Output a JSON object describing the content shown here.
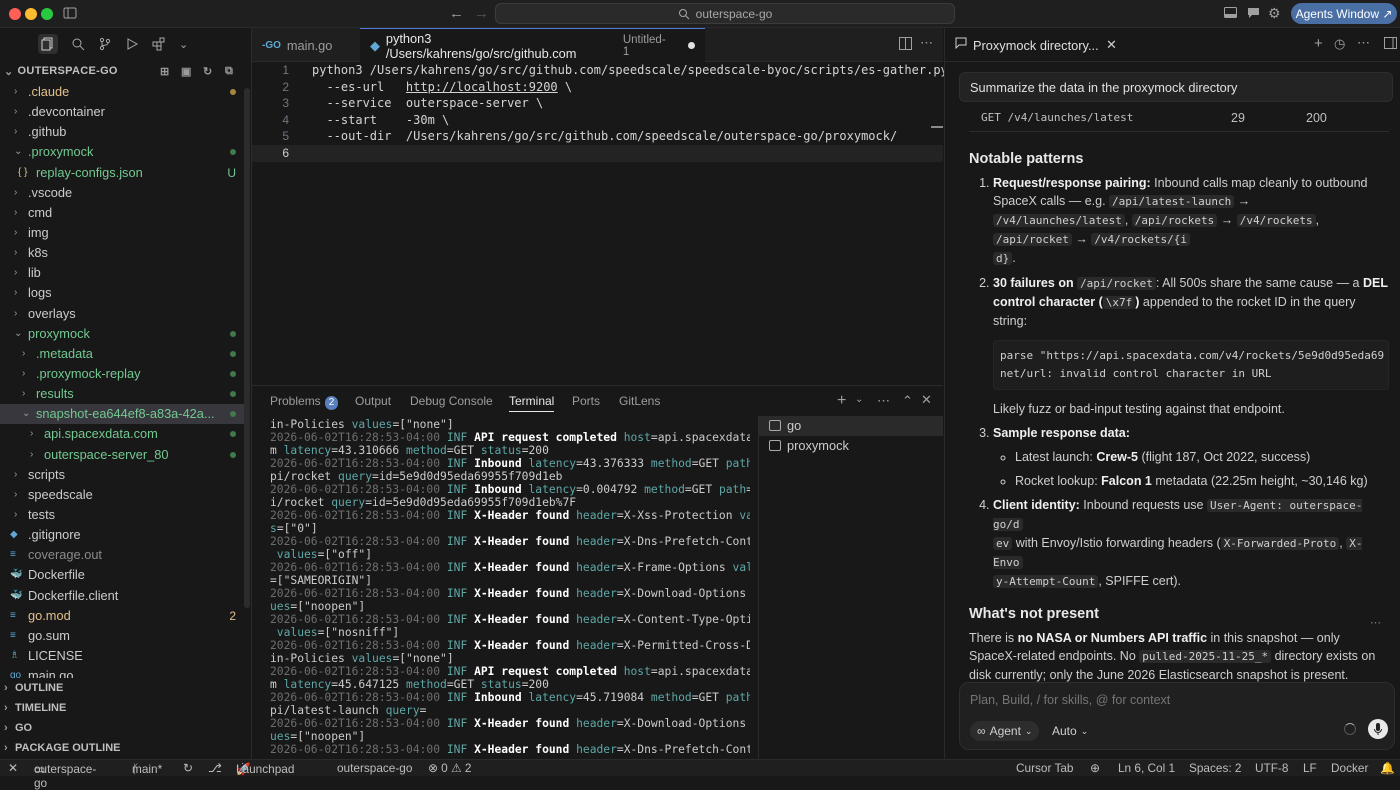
{
  "titlebar": {
    "search": "outerspace-go",
    "agents_button": "Agents Window ↗"
  },
  "explorer": {
    "title": "OUTERSPACE-GO",
    "items": [
      {
        "label": ".claude",
        "indent": 0,
        "chev": "›",
        "mark": "dot-yellow",
        "color": "#e2c08d"
      },
      {
        "label": ".devcontainer",
        "indent": 0,
        "chev": "›"
      },
      {
        "label": ".github",
        "indent": 0,
        "chev": "›"
      },
      {
        "label": ".proxymock",
        "indent": 0,
        "chev": "⌄",
        "mark": "dot",
        "color": "#73c991"
      },
      {
        "label": "replay-configs.json",
        "indent": 1,
        "icon": "{ }",
        "badge": "U",
        "color": "#73c991"
      },
      {
        "label": ".vscode",
        "indent": 0,
        "chev": "›"
      },
      {
        "label": "cmd",
        "indent": 0,
        "chev": "›"
      },
      {
        "label": "img",
        "indent": 0,
        "chev": "›"
      },
      {
        "label": "k8s",
        "indent": 0,
        "chev": "›"
      },
      {
        "label": "lib",
        "indent": 0,
        "chev": "›"
      },
      {
        "label": "logs",
        "indent": 0,
        "chev": "›"
      },
      {
        "label": "overlays",
        "indent": 0,
        "chev": "›"
      },
      {
        "label": "proxymock",
        "indent": 0,
        "chev": "⌄",
        "mark": "dot",
        "color": "#73c991"
      },
      {
        "label": ".metadata",
        "indent": 1,
        "chev": "›",
        "mark": "dot",
        "color": "#73c991"
      },
      {
        "label": ".proxymock-replay",
        "indent": 1,
        "chev": "›",
        "mark": "dot",
        "color": "#73c991"
      },
      {
        "label": "results",
        "indent": 1,
        "chev": "›",
        "mark": "dot",
        "color": "#73c991"
      },
      {
        "label": "snapshot-ea644ef8-a83a-42a...",
        "indent": 1,
        "chev": "⌄",
        "mark": "dot",
        "color": "#73c991",
        "selected": true
      },
      {
        "label": "api.spacexdata.com",
        "indent": 2,
        "chev": "›",
        "mark": "dot",
        "color": "#73c991"
      },
      {
        "label": "outerspace-server_80",
        "indent": 2,
        "chev": "›",
        "mark": "dot",
        "color": "#73c991"
      },
      {
        "label": "scripts",
        "indent": 0,
        "chev": "›"
      },
      {
        "label": "speedscale",
        "indent": 0,
        "chev": "›"
      },
      {
        "label": "tests",
        "indent": 0,
        "chev": "›"
      },
      {
        "label": ".gitignore",
        "indent": 0,
        "icon": "◆"
      },
      {
        "label": "coverage.out",
        "indent": 0,
        "icon": "≡",
        "color": "#8a8a8a"
      },
      {
        "label": "Dockerfile",
        "indent": 0,
        "icon": "🐳"
      },
      {
        "label": "Dockerfile.client",
        "indent": 0,
        "icon": "🐳"
      },
      {
        "label": "go.mod",
        "indent": 0,
        "icon": "≡",
        "badge": "2",
        "color": "#e2c08d"
      },
      {
        "label": "go.sum",
        "indent": 0,
        "icon": "≡"
      },
      {
        "label": "LICENSE",
        "indent": 0,
        "icon": "♗"
      },
      {
        "label": "main.go",
        "indent": 0,
        "icon": "go"
      }
    ],
    "sections": [
      "OUTLINE",
      "TIMELINE",
      "GO",
      "PACKAGE OUTLINE"
    ]
  },
  "editor": {
    "tabs": [
      {
        "icon": "-GO",
        "label": "main.go",
        "active": false
      },
      {
        "icon": "py",
        "label": "python3 /Users/kahrens/go/src/github.com",
        "suffix": "Untitled-1",
        "active": true
      }
    ],
    "lines": [
      {
        "n": "1",
        "text": "python3 /Users/kahrens/go/src/github.com/speedscale/speedscale-byoc/scripts/es-gather.py \\"
      },
      {
        "n": "2",
        "pre": "  --es-url   ",
        "url": "http://localhost:9200",
        "post": " \\"
      },
      {
        "n": "3",
        "text": "  --service  outerspace-server \\"
      },
      {
        "n": "4",
        "text": "  --start    -30m \\"
      },
      {
        "n": "5",
        "text": "  --out-dir  /Users/kahrens/go/src/github.com/speedscale/outerspace-go/proxymock/"
      },
      {
        "n": "6",
        "text": ""
      }
    ]
  },
  "panel": {
    "tabs": [
      "Problems",
      "Output",
      "Debug Console",
      "Terminal",
      "Ports",
      "GitLens"
    ],
    "problems_count": "2",
    "active_tab": "Terminal",
    "terminals": [
      "go",
      "proxymock"
    ],
    "term_lines": [
      [
        {
          "t": "in-Policies ",
          "c": ""
        },
        {
          "t": "values",
          "c": "k"
        },
        {
          "t": "=[\"none\"]",
          "c": ""
        }
      ],
      [
        {
          "t": "2026-06-02T16:28:53-04:00 ",
          "c": "ts"
        },
        {
          "t": "INF ",
          "c": "lv"
        },
        {
          "t": "API request completed ",
          "c": "bold"
        },
        {
          "t": "host",
          "c": "k"
        },
        {
          "t": "=api.spacexdata.co",
          "c": ""
        }
      ],
      [
        {
          "t": "m ",
          "c": ""
        },
        {
          "t": "latency",
          "c": "k"
        },
        {
          "t": "=43.310666 ",
          "c": ""
        },
        {
          "t": "method",
          "c": "k"
        },
        {
          "t": "=GET ",
          "c": ""
        },
        {
          "t": "status",
          "c": "k"
        },
        {
          "t": "=200",
          "c": ""
        }
      ],
      [
        {
          "t": "2026-06-02T16:28:53-04:00 ",
          "c": "ts"
        },
        {
          "t": "INF ",
          "c": "lv"
        },
        {
          "t": "Inbound ",
          "c": "bold"
        },
        {
          "t": "latency",
          "c": "k"
        },
        {
          "t": "=43.376333 ",
          "c": ""
        },
        {
          "t": "method",
          "c": "k"
        },
        {
          "t": "=GET ",
          "c": ""
        },
        {
          "t": "path",
          "c": "k"
        },
        {
          "t": "=/a",
          "c": ""
        }
      ],
      [
        {
          "t": "pi/rocket ",
          "c": ""
        },
        {
          "t": "query",
          "c": "k"
        },
        {
          "t": "=id=5e9d0d95eda69955f709d1eb",
          "c": ""
        }
      ],
      [
        {
          "t": "2026-06-02T16:28:53-04:00 ",
          "c": "ts"
        },
        {
          "t": "INF ",
          "c": "lv"
        },
        {
          "t": "Inbound ",
          "c": "bold"
        },
        {
          "t": "latency",
          "c": "k"
        },
        {
          "t": "=0.004792 ",
          "c": ""
        },
        {
          "t": "method",
          "c": "k"
        },
        {
          "t": "=GET ",
          "c": ""
        },
        {
          "t": "path",
          "c": "k"
        },
        {
          "t": "=/ap",
          "c": ""
        }
      ],
      [
        {
          "t": "i/rocket ",
          "c": ""
        },
        {
          "t": "query",
          "c": "k"
        },
        {
          "t": "=id=5e9d0d95eda69955f709d1eb%7F",
          "c": ""
        }
      ],
      [
        {
          "t": "2026-06-02T16:28:53-04:00 ",
          "c": "ts"
        },
        {
          "t": "INF ",
          "c": "lv"
        },
        {
          "t": "X-Header found ",
          "c": "bold"
        },
        {
          "t": "header",
          "c": "k"
        },
        {
          "t": "=X-Xss-Protection ",
          "c": ""
        },
        {
          "t": "value",
          "c": "k"
        }
      ],
      [
        {
          "t": "s",
          "c": "k"
        },
        {
          "t": "=[\"0\"]",
          "c": ""
        }
      ],
      [
        {
          "t": "2026-06-02T16:28:53-04:00 ",
          "c": "ts"
        },
        {
          "t": "INF ",
          "c": "lv"
        },
        {
          "t": "X-Header found ",
          "c": "bold"
        },
        {
          "t": "header",
          "c": "k"
        },
        {
          "t": "=X-Dns-Prefetch-Control",
          "c": ""
        }
      ],
      [
        {
          "t": " values",
          "c": "k"
        },
        {
          "t": "=[\"off\"]",
          "c": ""
        }
      ],
      [
        {
          "t": "2026-06-02T16:28:53-04:00 ",
          "c": "ts"
        },
        {
          "t": "INF ",
          "c": "lv"
        },
        {
          "t": "X-Header found ",
          "c": "bold"
        },
        {
          "t": "header",
          "c": "k"
        },
        {
          "t": "=X-Frame-Options ",
          "c": ""
        },
        {
          "t": "values",
          "c": "k"
        }
      ],
      [
        {
          "t": "=[\"SAMEORIGIN\"]",
          "c": ""
        }
      ],
      [
        {
          "t": "2026-06-02T16:28:53-04:00 ",
          "c": "ts"
        },
        {
          "t": "INF ",
          "c": "lv"
        },
        {
          "t": "X-Header found ",
          "c": "bold"
        },
        {
          "t": "header",
          "c": "k"
        },
        {
          "t": "=X-Download-Options ",
          "c": ""
        },
        {
          "t": "val",
          "c": "k"
        }
      ],
      [
        {
          "t": "ues",
          "c": "k"
        },
        {
          "t": "=[\"noopen\"]",
          "c": ""
        }
      ],
      [
        {
          "t": "2026-06-02T16:28:53-04:00 ",
          "c": "ts"
        },
        {
          "t": "INF ",
          "c": "lv"
        },
        {
          "t": "X-Header found ",
          "c": "bold"
        },
        {
          "t": "header",
          "c": "k"
        },
        {
          "t": "=X-Content-Type-Options",
          "c": ""
        }
      ],
      [
        {
          "t": " values",
          "c": "k"
        },
        {
          "t": "=[\"nosniff\"]",
          "c": ""
        }
      ],
      [
        {
          "t": "2026-06-02T16:28:53-04:00 ",
          "c": "ts"
        },
        {
          "t": "INF ",
          "c": "lv"
        },
        {
          "t": "X-Header found ",
          "c": "bold"
        },
        {
          "t": "header",
          "c": "k"
        },
        {
          "t": "=X-Permitted-Cross-Doma",
          "c": ""
        }
      ],
      [
        {
          "t": "in-Policies ",
          "c": ""
        },
        {
          "t": "values",
          "c": "k"
        },
        {
          "t": "=[\"none\"]",
          "c": ""
        }
      ],
      [
        {
          "t": "2026-06-02T16:28:53-04:00 ",
          "c": "ts"
        },
        {
          "t": "INF ",
          "c": "lv"
        },
        {
          "t": "API request completed ",
          "c": "bold"
        },
        {
          "t": "host",
          "c": "k"
        },
        {
          "t": "=api.spacexdata.co",
          "c": ""
        }
      ],
      [
        {
          "t": "m ",
          "c": ""
        },
        {
          "t": "latency",
          "c": "k"
        },
        {
          "t": "=45.647125 ",
          "c": ""
        },
        {
          "t": "method",
          "c": "k"
        },
        {
          "t": "=GET ",
          "c": ""
        },
        {
          "t": "status",
          "c": "k"
        },
        {
          "t": "=200",
          "c": ""
        }
      ],
      [
        {
          "t": "2026-06-02T16:28:53-04:00 ",
          "c": "ts"
        },
        {
          "t": "INF ",
          "c": "lv"
        },
        {
          "t": "Inbound ",
          "c": "bold"
        },
        {
          "t": "latency",
          "c": "k"
        },
        {
          "t": "=45.719084 ",
          "c": ""
        },
        {
          "t": "method",
          "c": "k"
        },
        {
          "t": "=GET ",
          "c": ""
        },
        {
          "t": "path",
          "c": "k"
        },
        {
          "t": "=/a",
          "c": ""
        }
      ],
      [
        {
          "t": "pi/latest-launch ",
          "c": ""
        },
        {
          "t": "query",
          "c": "k"
        },
        {
          "t": "=",
          "c": ""
        }
      ],
      [
        {
          "t": "2026-06-02T16:28:53-04:00 ",
          "c": "ts"
        },
        {
          "t": "INF ",
          "c": "lv"
        },
        {
          "t": "X-Header found ",
          "c": "bold"
        },
        {
          "t": "header",
          "c": "k"
        },
        {
          "t": "=X-Download-Options ",
          "c": ""
        },
        {
          "t": "val",
          "c": "k"
        }
      ],
      [
        {
          "t": "ues",
          "c": "k"
        },
        {
          "t": "=[\"noopen\"]",
          "c": ""
        }
      ],
      [
        {
          "t": "2026-06-02T16:28:53-04:00 ",
          "c": "ts"
        },
        {
          "t": "INF ",
          "c": "lv"
        },
        {
          "t": "X-Header found ",
          "c": "bold"
        },
        {
          "t": "header",
          "c": "k"
        },
        {
          "t": "=X-Dns-Prefetch-Control",
          "c": ""
        }
      ]
    ]
  },
  "chat": {
    "tab_title": "Proxymock directory...",
    "user_message": "Summarize the data in the proxymock directory",
    "table_row": {
      "endpoint": "GET /v4/launches/latest",
      "count": "29",
      "status": "200"
    },
    "notable_title": "Notable patterns",
    "p1_bold": "Request/response pairing:",
    "p1_text": " Inbound calls map cleanly to outbound SpaceX calls — e.g. ",
    "p1_code1": "/api/latest-launch",
    "p1_code2": "/v4/launches/latest",
    "p1_code3": "/api/rockets",
    "p1_code4": "/v4/rockets",
    "p1_code5": "/api/rocket",
    "p1_code6": "/v4/rockets/{i",
    "p1_code6b": "d}",
    "p2_bold1": "30 failures on ",
    "p2_code": "/api/rocket",
    "p2_text": ": All 500s share the same cause — a ",
    "p2_bold2": "DEL control character (",
    "p2_code2": "\\x7f",
    "p2_bold3": ")",
    "p2_text2": " appended to the rocket ID in the query string:",
    "code_block_1": "parse \"https://api.spacexdata.com/v4/rockets/5e9d0d95eda69",
    "code_block_2": "net/url: invalid control character in URL",
    "p2_after": "Likely fuzz or bad-input testing against that endpoint.",
    "p3_bold": "Sample response data:",
    "p3_b1_pre": "Latest launch: ",
    "p3_b1_bold": "Crew-5",
    "p3_b1_post": " (flight 187, Oct 2022, success)",
    "p3_b2_pre": "Rocket lookup: ",
    "p3_b2_bold": "Falcon 1",
    "p3_b2_post": " metadata (22.25m height, ~30,146 kg)",
    "p4_bold": "Client identity:",
    "p4_text": " Inbound requests use ",
    "p4_code1": "User-Agent: outerspace-go/d",
    "p4_code1b": "ev",
    "p4_text2": " with Envoy/Istio forwarding headers (",
    "p4_code2": "X-Forwarded-Proto",
    "p4_code3": "X-Envo",
    "p4_code3b": "y-Attempt-Count",
    "p4_text3": ", SPIFFE cert).",
    "notpresent_title": "What's not present",
    "np_text1": "There is ",
    "np_bold": "no NASA or Numbers API traffic",
    "np_text2": " in this snapshot — only SpaceX-related endpoints. No ",
    "np_code": "pulled-2025-11-25_*",
    "np_text3": " directory exists on disk currently; only the June 2026 Elasticsearch snapshot is present.",
    "composer_placeholder": "Plan, Build, / for skills, @ for context",
    "agent_label": "Agent",
    "auto_label": "Auto"
  },
  "status": {
    "repo": "outerspace-go",
    "branch": "main*",
    "launchpad": "Launchpad",
    "project": "outerspace-go",
    "problems": "⊗ 0 ⚠ 2",
    "cursor_tab": "Cursor Tab",
    "position": "Ln 6, Col 1",
    "spaces": "Spaces: 2",
    "encoding": "UTF-8",
    "eol": "LF",
    "language": "Docker"
  }
}
